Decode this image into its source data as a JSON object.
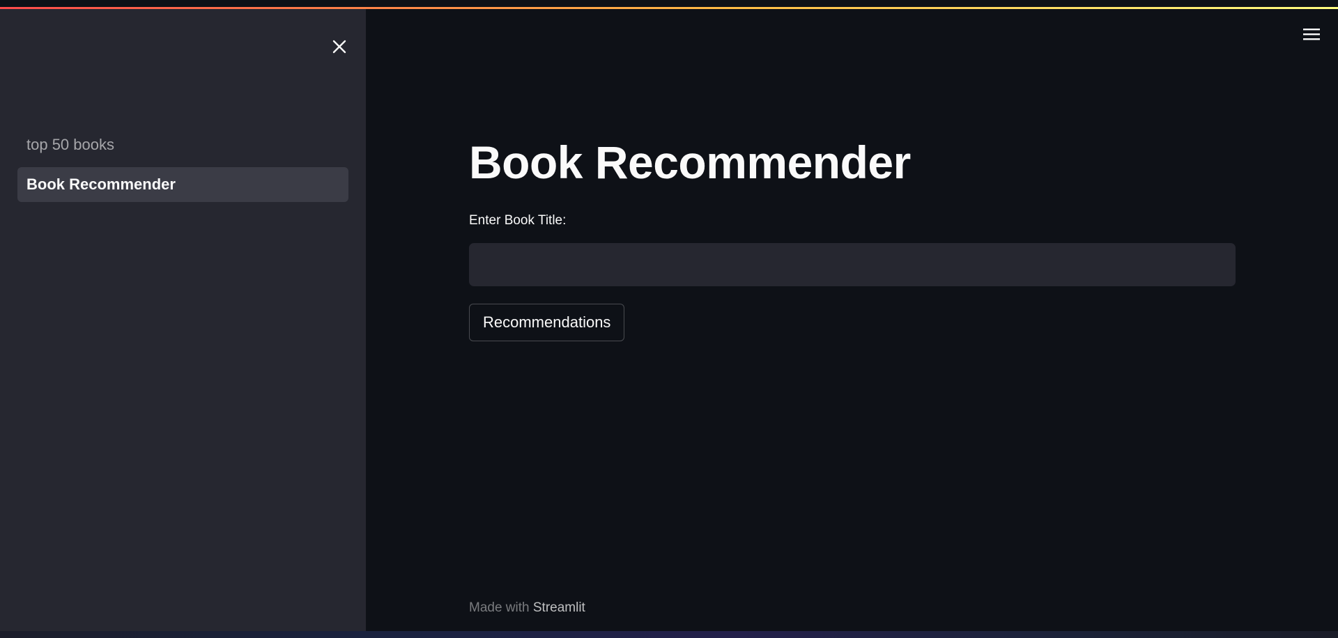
{
  "colors": {
    "background": "#0e1117",
    "sidebar": "#262730",
    "active_item": "#3b3c46",
    "text": "#fafafa",
    "accent_gradient": [
      "#ff4b4b",
      "#ffbd45",
      "#fffd80"
    ]
  },
  "header": {
    "close_icon": "close-icon",
    "menu_icon": "hamburger-menu-icon"
  },
  "sidebar": {
    "items": [
      {
        "label": "top 50 books",
        "active": false
      },
      {
        "label": "Book Recommender",
        "active": true
      }
    ]
  },
  "main": {
    "title": "Book Recommender",
    "input": {
      "label": "Enter Book Title:",
      "value": "",
      "placeholder": ""
    },
    "button_label": "Recommendations"
  },
  "footer": {
    "prefix": "Made with ",
    "brand": "Streamlit"
  }
}
